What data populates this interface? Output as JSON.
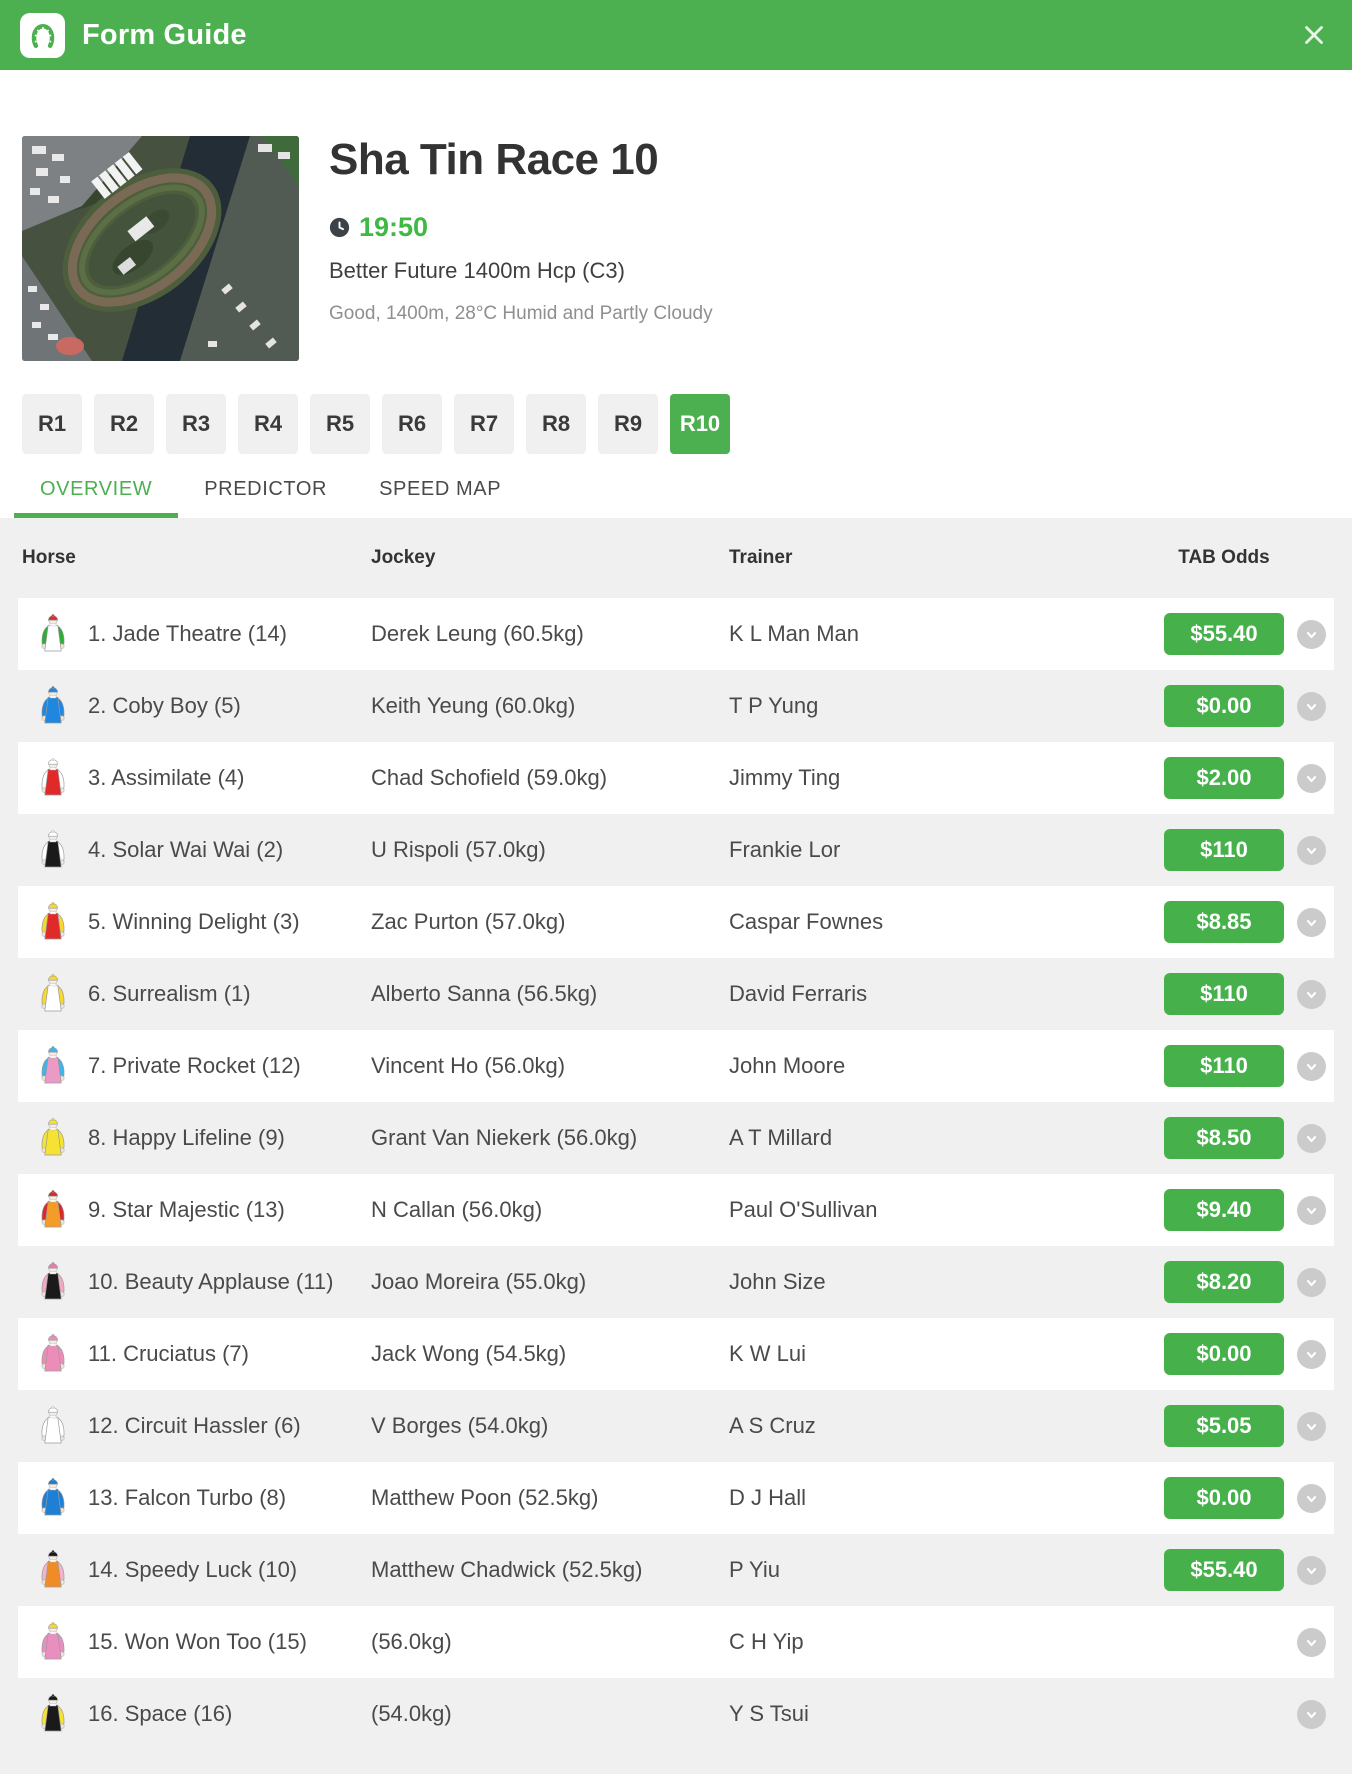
{
  "colors": {
    "accent": "#4caf50",
    "odds_button": "#46b14b",
    "time_text": "#3fb943"
  },
  "icons": {
    "app": "horseshoe-icon",
    "close": "close-icon",
    "time": "clock-icon",
    "row_expand": "chevron-down-icon"
  },
  "topbar": {
    "title": "Form Guide"
  },
  "race": {
    "title": "Sha Tin Race 10",
    "time": "19:50",
    "name": "Better Future 1400m Hcp (C3)",
    "conditions": "Good, 1400m, 28°C Humid and Partly Cloudy"
  },
  "race_nav": [
    {
      "label": "R1",
      "selected": false
    },
    {
      "label": "R2",
      "selected": false
    },
    {
      "label": "R3",
      "selected": false
    },
    {
      "label": "R4",
      "selected": false
    },
    {
      "label": "R5",
      "selected": false
    },
    {
      "label": "R6",
      "selected": false
    },
    {
      "label": "R7",
      "selected": false
    },
    {
      "label": "R8",
      "selected": false
    },
    {
      "label": "R9",
      "selected": false
    },
    {
      "label": "R10",
      "selected": true
    }
  ],
  "tabs": [
    {
      "label": "OVERVIEW",
      "selected": true
    },
    {
      "label": "PREDICTOR",
      "selected": false
    },
    {
      "label": "SPEED MAP",
      "selected": false
    }
  ],
  "table": {
    "columns": {
      "horse": "Horse",
      "jockey": "Jockey",
      "trainer": "Trainer",
      "odds": "TAB Odds"
    },
    "rows": [
      {
        "horse": "1. Jade Theatre (14)",
        "jockey": "Derek Leung (60.5kg)",
        "trainer": "K L Man Man",
        "odds": "$55.40",
        "silks": {
          "body": "#ffffff",
          "sleeves": "#2eac36",
          "cap": "#d63131"
        }
      },
      {
        "horse": "2. Coby Boy (5)",
        "jockey": "Keith Yeung (60.0kg)",
        "trainer": "T P Yung",
        "odds": "$0.00",
        "silks": {
          "body": "#1f87e0",
          "sleeves": "#1f87e0",
          "cap": "#1f87e0"
        }
      },
      {
        "horse": "3. Assimilate (4)",
        "jockey": "Chad Schofield (59.0kg)",
        "trainer": "Jimmy Ting",
        "odds": "$2.00",
        "silks": {
          "body": "#e02a2a",
          "sleeves": "#ffffff",
          "cap": "#ffffff"
        }
      },
      {
        "horse": "4. Solar Wai Wai (2)",
        "jockey": "U Rispoli (57.0kg)",
        "trainer": "Frankie Lor",
        "odds": "$110",
        "silks": {
          "body": "#1a1a1a",
          "sleeves": "#ffffff",
          "cap": "#ffffff"
        }
      },
      {
        "horse": "5. Winning Delight (3)",
        "jockey": "Zac Purton (57.0kg)",
        "trainer": "Caspar Fownes",
        "odds": "$8.85",
        "silks": {
          "body": "#e02a2a",
          "sleeves": "#f5d832",
          "cap": "#f5d832"
        }
      },
      {
        "horse": "6. Surrealism (1)",
        "jockey": "Alberto Sanna (56.5kg)",
        "trainer": "David Ferraris",
        "odds": "$110",
        "silks": {
          "body": "#ffffff",
          "sleeves": "#f5d832",
          "cap": "#f5d832"
        }
      },
      {
        "horse": "7. Private Rocket (12)",
        "jockey": "Vincent Ho (56.0kg)",
        "trainer": "John Moore",
        "odds": "$110",
        "silks": {
          "body": "#eb9ac6",
          "sleeves": "#3fb3ea",
          "cap": "#3fb3ea"
        }
      },
      {
        "horse": "8. Happy Lifeline (9)",
        "jockey": "Grant Van Niekerk (56.0kg)",
        "trainer": "A T Millard",
        "odds": "$8.50",
        "silks": {
          "body": "#f5e232",
          "sleeves": "#f5e232",
          "cap": "#f5e232"
        }
      },
      {
        "horse": "9. Star Majestic (13)",
        "jockey": "N Callan (56.0kg)",
        "trainer": "Paul O'Sullivan",
        "odds": "$9.40",
        "silks": {
          "body": "#f59b28",
          "sleeves": "#d62b2b",
          "cap": "#d62b2b"
        }
      },
      {
        "horse": "10. Beauty Applause (11)",
        "jockey": "Joao Moreira (55.0kg)",
        "trainer": "John Size",
        "odds": "$8.20",
        "silks": {
          "body": "#1a1a1a",
          "sleeves": "#f2a9c4",
          "cap": "#e87ab0"
        }
      },
      {
        "horse": "11. Cruciatus (7)",
        "jockey": "Jack Wong (54.5kg)",
        "trainer": "K W Lui",
        "odds": "$0.00",
        "silks": {
          "body": "#ec8cb8",
          "sleeves": "#ec8cb8",
          "cap": "#ec8cb8"
        }
      },
      {
        "horse": "12. Circuit Hassler (6)",
        "jockey": "V Borges (54.0kg)",
        "trainer": "A S Cruz",
        "odds": "$5.05",
        "silks": {
          "body": "#ffffff",
          "sleeves": "#ffffff",
          "cap": "#ffffff"
        }
      },
      {
        "horse": "13. Falcon Turbo (8)",
        "jockey": "Matthew Poon (52.5kg)",
        "trainer": "D J Hall",
        "odds": "$0.00",
        "silks": {
          "body": "#1f7fd4",
          "sleeves": "#1f7fd4",
          "cap": "#1f7fd4"
        }
      },
      {
        "horse": "14. Speedy Luck (10)",
        "jockey": "Matthew Chadwick (52.5kg)",
        "trainer": "P Yiu",
        "odds": "$55.40",
        "silks": {
          "body": "#f08c28",
          "sleeves": "#f2b3cb",
          "cap": "#1a1a1a"
        }
      },
      {
        "horse": "15. Won Won Too (15)",
        "jockey": "(56.0kg)",
        "trainer": "C H Yip",
        "odds": null,
        "silks": {
          "body": "#e88fc0",
          "sleeves": "#e88fc0",
          "cap": "#f5d832"
        }
      },
      {
        "horse": "16. Space (16)",
        "jockey": "(54.0kg)",
        "trainer": "Y S Tsui",
        "odds": null,
        "silks": {
          "body": "#1a1a1a",
          "sleeves": "#f5e232",
          "cap": "#1a1a1a"
        }
      }
    ]
  }
}
